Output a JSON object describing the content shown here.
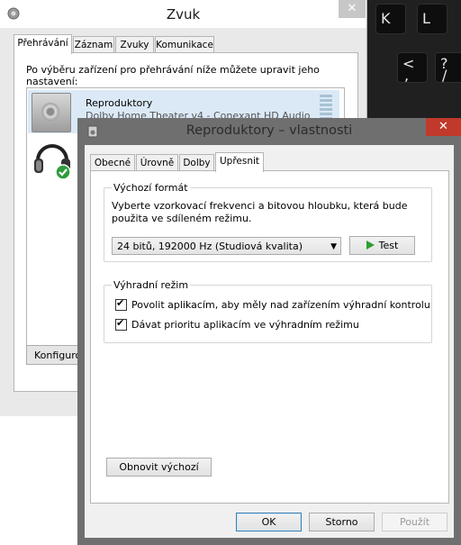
{
  "keyboard": {
    "keys": [
      "K",
      "L",
      "<",
      ",",
      "?",
      "/"
    ]
  },
  "sound_window": {
    "title": "Zvuk",
    "close_glyph": "✕",
    "tabs": [
      "Přehrávání",
      "Záznam",
      "Zvuky",
      "Komunikace"
    ],
    "description": "Po výběru zařízení pro přehrávání níže můžete upravit jeho nastavení:",
    "devices": [
      {
        "name": "Reproduktory",
        "detail": "Dolby Home Theater v4 - Conexant HD Audio",
        "icon": "speaker-icon"
      },
      {
        "name": "",
        "detail": "",
        "icon": "headphones-default-icon"
      }
    ],
    "configure_label": "Konfigurovat"
  },
  "properties_dialog": {
    "title": "Reproduktory – vlastnosti",
    "close_glyph": "✕",
    "tabs": [
      "Obecné",
      "Úrovně",
      "Dolby",
      "Upřesnit"
    ],
    "active_tab": "Upřesnit",
    "default_format": {
      "group_title": "Výchozí formát",
      "description_line1": "Vyberte vzorkovací frekvenci a bitovou hloubku, která bude",
      "description_line2": "použita ve sdíleném režimu.",
      "selected_format": "24 bitů, 192000 Hz (Studiová kvalita)",
      "test_label": "Test"
    },
    "exclusive_mode": {
      "group_title": "Výhradní režim",
      "options": [
        {
          "label": "Povolit aplikacím, aby měly nad zařízením výhradní kontrolu",
          "checked": true
        },
        {
          "label": "Dávat prioritu aplikacím ve výhradním režimu",
          "checked": true
        }
      ]
    },
    "restore_defaults_label": "Obnovit výchozí",
    "buttons": {
      "ok": "OK",
      "cancel": "Storno",
      "apply": "Použít"
    }
  },
  "colors": {
    "close_red": "#c0392b",
    "selection_blue": "#dbe9f7",
    "test_green": "#2f9e2f"
  }
}
